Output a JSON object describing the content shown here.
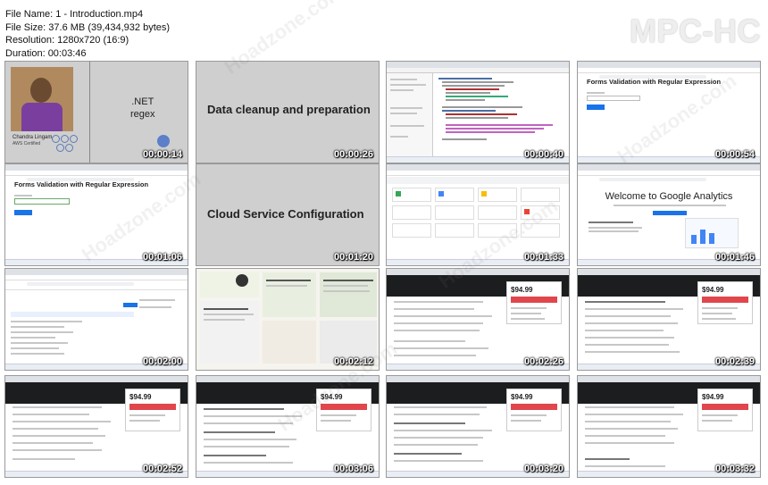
{
  "file_info": {
    "name": "File Name: 1 - Introduction.mp4",
    "size": "File Size: 37.6 MB (39,434,932 bytes)",
    "resolution": "Resolution: 1280x720 (16:9)",
    "duration": "Duration: 00:03:46"
  },
  "brand": "MPC-HC",
  "watermark": "Hoadzone.com",
  "thumbnails": [
    {
      "timestamp": "00:00:14",
      "title_line1": ".NET",
      "title_line2": "regex",
      "speaker_name": "Chandra Lingam",
      "speaker_subtitle": "AWS Certified"
    },
    {
      "timestamp": "00:00:26",
      "title": "Data cleanup and preparation"
    },
    {
      "timestamp": "00:00:40"
    },
    {
      "timestamp": "00:00:54",
      "title": "Forms Validation with Regular Expression"
    },
    {
      "timestamp": "00:01:06",
      "title": "Forms Validation with Regular Expression"
    },
    {
      "timestamp": "00:01:20",
      "title": "Cloud Service Configuration"
    },
    {
      "timestamp": "00:01:33"
    },
    {
      "timestamp": "00:01:46",
      "title": "Welcome to Google Analytics"
    },
    {
      "timestamp": "00:02:00"
    },
    {
      "timestamp": "00:02:12"
    },
    {
      "timestamp": "00:02:26",
      "price": "$94.99"
    },
    {
      "timestamp": "00:02:39",
      "price": "$94.99"
    },
    {
      "timestamp": "00:02:52",
      "price": "$94.99"
    },
    {
      "timestamp": "00:03:06",
      "price": "$94.99"
    },
    {
      "timestamp": "00:03:20",
      "price": "$94.99"
    },
    {
      "timestamp": "00:03:32",
      "price": "$94.99"
    }
  ]
}
